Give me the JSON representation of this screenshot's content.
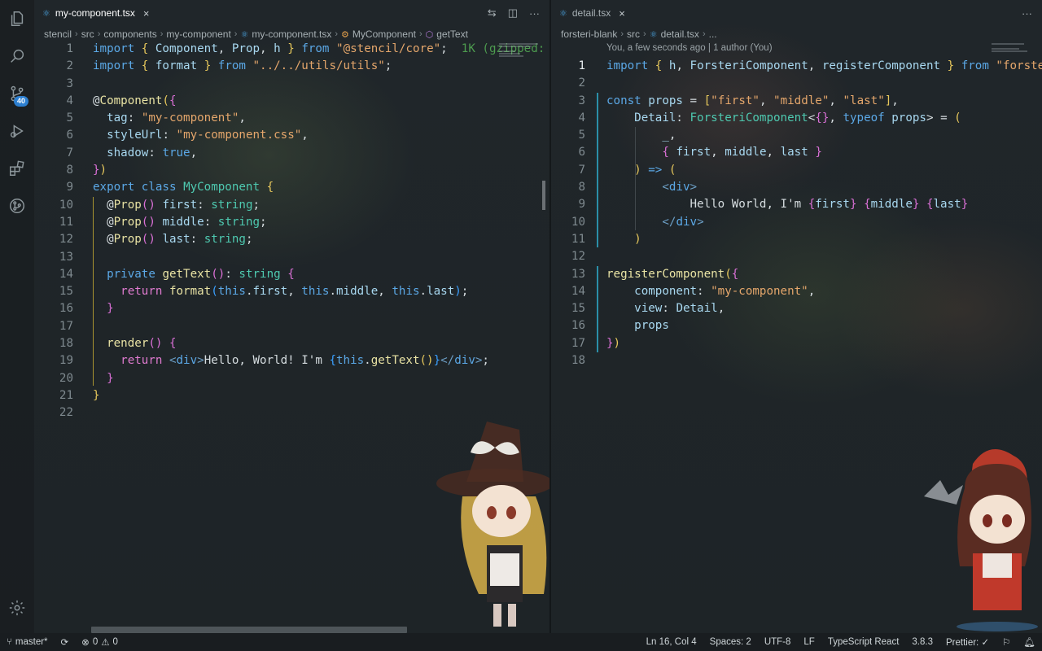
{
  "activity_bar": {
    "items": [
      {
        "name": "files-icon"
      },
      {
        "name": "search-icon"
      },
      {
        "name": "source-control-icon",
        "badge": "40"
      },
      {
        "name": "run-debug-icon"
      },
      {
        "name": "extensions-icon"
      },
      {
        "name": "git-graph-icon"
      }
    ],
    "settings_icon": "gear-icon"
  },
  "left_editor": {
    "tab": {
      "label": "my-component.tsx",
      "close": "×"
    },
    "actions": {
      "compare": "⇆",
      "split": "◫",
      "more": "···"
    },
    "breadcrumb": [
      "stencil",
      "src",
      "components",
      "my-component",
      "my-component.tsx",
      "MyComponent",
      "getText"
    ],
    "lines": [
      {
        "n": "1",
        "tokens": [
          [
            "k",
            "import"
          ],
          [
            "w",
            " "
          ],
          [
            "p",
            "{"
          ],
          [
            "w",
            " "
          ],
          [
            "v",
            "Component"
          ],
          [
            "w",
            ", "
          ],
          [
            "v",
            "Prop"
          ],
          [
            "w",
            ", "
          ],
          [
            "v",
            "h"
          ],
          [
            "w",
            " "
          ],
          [
            "p",
            "}"
          ],
          [
            "w",
            " "
          ],
          [
            "k",
            "from"
          ],
          [
            "w",
            " "
          ],
          [
            "s",
            "\"@stencil/core\""
          ],
          [
            "w",
            ";  "
          ],
          [
            "green",
            "1K (gzipped:"
          ]
        ]
      },
      {
        "n": "2",
        "tokens": [
          [
            "k",
            "import"
          ],
          [
            "w",
            " "
          ],
          [
            "p",
            "{"
          ],
          [
            "w",
            " "
          ],
          [
            "v",
            "format"
          ],
          [
            "w",
            " "
          ],
          [
            "p",
            "}"
          ],
          [
            "w",
            " "
          ],
          [
            "k",
            "from"
          ],
          [
            "w",
            " "
          ],
          [
            "s",
            "\"../../utils/utils\""
          ],
          [
            "w",
            ";"
          ]
        ]
      },
      {
        "n": "3",
        "tokens": []
      },
      {
        "n": "4",
        "tokens": [
          [
            "w",
            "@"
          ],
          [
            "f",
            "Component"
          ],
          [
            "p",
            "("
          ],
          [
            "p2",
            "{"
          ]
        ]
      },
      {
        "n": "5",
        "tokens": [
          [
            "w",
            "  "
          ],
          [
            "v",
            "tag"
          ],
          [
            "w",
            ": "
          ],
          [
            "s",
            "\"my-component\""
          ],
          [
            "w",
            ","
          ]
        ]
      },
      {
        "n": "6",
        "tokens": [
          [
            "w",
            "  "
          ],
          [
            "v",
            "styleUrl"
          ],
          [
            "w",
            ": "
          ],
          [
            "s",
            "\"my-component.css\""
          ],
          [
            "w",
            ","
          ]
        ]
      },
      {
        "n": "7",
        "tokens": [
          [
            "w",
            "  "
          ],
          [
            "v",
            "shadow"
          ],
          [
            "w",
            ": "
          ],
          [
            "k",
            "true"
          ],
          [
            "w",
            ","
          ]
        ]
      },
      {
        "n": "8",
        "tokens": [
          [
            "p2",
            "}"
          ],
          [
            "p",
            ")"
          ]
        ]
      },
      {
        "n": "9",
        "tokens": [
          [
            "k",
            "export"
          ],
          [
            "w",
            " "
          ],
          [
            "k",
            "class"
          ],
          [
            "w",
            " "
          ],
          [
            "c",
            "MyComponent"
          ],
          [
            "w",
            " "
          ],
          [
            "p",
            "{"
          ]
        ]
      },
      {
        "n": "10",
        "tokens": [
          [
            "w",
            "  @"
          ],
          [
            "f",
            "Prop"
          ],
          [
            "p2",
            "()"
          ],
          [
            "w",
            " "
          ],
          [
            "v",
            "first"
          ],
          [
            "w",
            ": "
          ],
          [
            "t",
            "string"
          ],
          [
            "w",
            ";"
          ]
        ]
      },
      {
        "n": "11",
        "tokens": [
          [
            "w",
            "  @"
          ],
          [
            "f",
            "Prop"
          ],
          [
            "p2",
            "()"
          ],
          [
            "w",
            " "
          ],
          [
            "v",
            "middle"
          ],
          [
            "w",
            ": "
          ],
          [
            "t",
            "string"
          ],
          [
            "w",
            ";"
          ]
        ]
      },
      {
        "n": "12",
        "tokens": [
          [
            "w",
            "  @"
          ],
          [
            "f",
            "Prop"
          ],
          [
            "p2",
            "()"
          ],
          [
            "w",
            " "
          ],
          [
            "v",
            "last"
          ],
          [
            "w",
            ": "
          ],
          [
            "t",
            "string"
          ],
          [
            "w",
            ";"
          ]
        ]
      },
      {
        "n": "13",
        "tokens": []
      },
      {
        "n": "14",
        "tokens": [
          [
            "w",
            "  "
          ],
          [
            "k",
            "private"
          ],
          [
            "w",
            " "
          ],
          [
            "f",
            "getText"
          ],
          [
            "p2",
            "()"
          ],
          [
            "w",
            ": "
          ],
          [
            "t",
            "string"
          ],
          [
            "w",
            " "
          ],
          [
            "p2",
            "{"
          ]
        ]
      },
      {
        "n": "15",
        "tokens": [
          [
            "w",
            "    "
          ],
          [
            "k2",
            "return"
          ],
          [
            "w",
            " "
          ],
          [
            "f",
            "format"
          ],
          [
            "p3",
            "("
          ],
          [
            "k",
            "this"
          ],
          [
            "w",
            "."
          ],
          [
            "v",
            "first"
          ],
          [
            "w",
            ", "
          ],
          [
            "k",
            "this"
          ],
          [
            "w",
            "."
          ],
          [
            "v",
            "middle"
          ],
          [
            "w",
            ", "
          ],
          [
            "k",
            "this"
          ],
          [
            "w",
            "."
          ],
          [
            "v",
            "last"
          ],
          [
            "p3",
            ")"
          ],
          [
            "w",
            ";"
          ]
        ]
      },
      {
        "n": "16",
        "tokens": [
          [
            "w",
            "  "
          ],
          [
            "p2",
            "}"
          ]
        ]
      },
      {
        "n": "17",
        "tokens": []
      },
      {
        "n": "18",
        "tokens": [
          [
            "w",
            "  "
          ],
          [
            "f",
            "render"
          ],
          [
            "p2",
            "()"
          ],
          [
            "w",
            " "
          ],
          [
            "p2",
            "{"
          ]
        ]
      },
      {
        "n": "19",
        "tokens": [
          [
            "w",
            "    "
          ],
          [
            "k2",
            "return"
          ],
          [
            "w",
            " "
          ],
          [
            "tag",
            "<"
          ],
          [
            "d",
            "div"
          ],
          [
            "tag",
            ">"
          ],
          [
            "w",
            "Hello, World! I'm "
          ],
          [
            "p3",
            "{"
          ],
          [
            "k",
            "this"
          ],
          [
            "w",
            "."
          ],
          [
            "f",
            "getText"
          ],
          [
            "p",
            "()"
          ],
          [
            "p3",
            "}"
          ],
          [
            "tag",
            "</"
          ],
          [
            "d",
            "div"
          ],
          [
            "tag",
            ">"
          ],
          [
            "w",
            ";"
          ]
        ]
      },
      {
        "n": "20",
        "tokens": [
          [
            "w",
            "  "
          ],
          [
            "p2",
            "}"
          ]
        ]
      },
      {
        "n": "21",
        "tokens": [
          [
            "p",
            "}"
          ]
        ]
      },
      {
        "n": "22",
        "tokens": []
      }
    ]
  },
  "right_editor": {
    "tab": {
      "label": "detail.tsx",
      "close": "×"
    },
    "actions": {
      "more": "···"
    },
    "breadcrumb": [
      "forsteri-blank",
      "src",
      "detail.tsx",
      "..."
    ],
    "blame": "You, a few seconds ago | 1 author (You)",
    "lines": [
      {
        "n": "1",
        "tokens": [
          [
            "k",
            "import"
          ],
          [
            "w",
            " "
          ],
          [
            "p",
            "{"
          ],
          [
            "w",
            " "
          ],
          [
            "v",
            "h"
          ],
          [
            "w",
            ", "
          ],
          [
            "v",
            "ForsteriComponent"
          ],
          [
            "w",
            ", "
          ],
          [
            "v",
            "registerComponent"
          ],
          [
            "w",
            " "
          ],
          [
            "p",
            "}"
          ],
          [
            "w",
            " "
          ],
          [
            "k",
            "from"
          ],
          [
            "w",
            " "
          ],
          [
            "s",
            "\"forsteri\""
          ]
        ]
      },
      {
        "n": "2",
        "tokens": []
      },
      {
        "n": "3",
        "tokens": [
          [
            "k",
            "const"
          ],
          [
            "w",
            " "
          ],
          [
            "v",
            "props"
          ],
          [
            "w",
            " = "
          ],
          [
            "p",
            "["
          ],
          [
            "s",
            "\"first\""
          ],
          [
            "w",
            ", "
          ],
          [
            "s",
            "\"middle\""
          ],
          [
            "w",
            ", "
          ],
          [
            "s",
            "\"last\""
          ],
          [
            "p",
            "]"
          ],
          [
            "w",
            ","
          ]
        ]
      },
      {
        "n": "4",
        "tokens": [
          [
            "w",
            "    "
          ],
          [
            "v",
            "Detail"
          ],
          [
            "w",
            ": "
          ],
          [
            "c",
            "ForsteriComponent"
          ],
          [
            "w",
            "<"
          ],
          [
            "p2",
            "{}"
          ],
          [
            "w",
            ", "
          ],
          [
            "k",
            "typeof"
          ],
          [
            "w",
            " "
          ],
          [
            "v",
            "props"
          ],
          [
            "w",
            "> = "
          ],
          [
            "p",
            "("
          ]
        ]
      },
      {
        "n": "5",
        "tokens": [
          [
            "w",
            "        "
          ],
          [
            "v",
            "_"
          ],
          [
            "w",
            ","
          ]
        ]
      },
      {
        "n": "6",
        "tokens": [
          [
            "w",
            "        "
          ],
          [
            "p2",
            "{"
          ],
          [
            "w",
            " "
          ],
          [
            "v",
            "first"
          ],
          [
            "w",
            ", "
          ],
          [
            "v",
            "middle"
          ],
          [
            "w",
            ", "
          ],
          [
            "v",
            "last"
          ],
          [
            "w",
            " "
          ],
          [
            "p2",
            "}"
          ]
        ]
      },
      {
        "n": "7",
        "tokens": [
          [
            "w",
            "    "
          ],
          [
            "p",
            ")"
          ],
          [
            "w",
            " "
          ],
          [
            "k",
            "=>"
          ],
          [
            "w",
            " "
          ],
          [
            "p",
            "("
          ]
        ]
      },
      {
        "n": "8",
        "tokens": [
          [
            "w",
            "        "
          ],
          [
            "tag",
            "<"
          ],
          [
            "d",
            "div"
          ],
          [
            "tag",
            ">"
          ]
        ]
      },
      {
        "n": "9",
        "tokens": [
          [
            "w",
            "            Hello World, I'm "
          ],
          [
            "p2",
            "{"
          ],
          [
            "v",
            "first"
          ],
          [
            "p2",
            "}"
          ],
          [
            "w",
            " "
          ],
          [
            "p2",
            "{"
          ],
          [
            "v",
            "middle"
          ],
          [
            "p2",
            "}"
          ],
          [
            "w",
            " "
          ],
          [
            "p2",
            "{"
          ],
          [
            "v",
            "last"
          ],
          [
            "p2",
            "}"
          ]
        ]
      },
      {
        "n": "10",
        "tokens": [
          [
            "w",
            "        "
          ],
          [
            "tag",
            "</"
          ],
          [
            "d",
            "div"
          ],
          [
            "tag",
            ">"
          ]
        ]
      },
      {
        "n": "11",
        "tokens": [
          [
            "w",
            "    "
          ],
          [
            "p",
            ")"
          ]
        ]
      },
      {
        "n": "12",
        "tokens": []
      },
      {
        "n": "13",
        "tokens": [
          [
            "f",
            "registerComponent"
          ],
          [
            "p",
            "("
          ],
          [
            "p2",
            "{"
          ]
        ]
      },
      {
        "n": "14",
        "tokens": [
          [
            "w",
            "    "
          ],
          [
            "v",
            "component"
          ],
          [
            "w",
            ": "
          ],
          [
            "s",
            "\"my-component\""
          ],
          [
            "w",
            ","
          ]
        ]
      },
      {
        "n": "15",
        "tokens": [
          [
            "w",
            "    "
          ],
          [
            "v",
            "view"
          ],
          [
            "w",
            ": "
          ],
          [
            "v",
            "Detail"
          ],
          [
            "w",
            ","
          ]
        ]
      },
      {
        "n": "16",
        "tokens": [
          [
            "w",
            "    "
          ],
          [
            "v",
            "props"
          ]
        ]
      },
      {
        "n": "17",
        "tokens": [
          [
            "p2",
            "}"
          ],
          [
            "p",
            ")"
          ]
        ]
      },
      {
        "n": "18",
        "tokens": []
      }
    ]
  },
  "status_bar": {
    "branch": "master*",
    "sync_icon": "⟳",
    "errors": "0",
    "warnings": "0",
    "position": "Ln 16, Col 4",
    "spaces": "Spaces: 2",
    "encoding": "UTF-8",
    "eol": "LF",
    "language": "TypeScript React",
    "version": "3.8.3",
    "prettier": "Prettier: ✓"
  },
  "colors": {
    "accent": "#2d7fd0",
    "string": "#e4a66b",
    "keyword": "#5ba8e6",
    "function": "#e9e3a4",
    "class": "#4ec9b0"
  }
}
